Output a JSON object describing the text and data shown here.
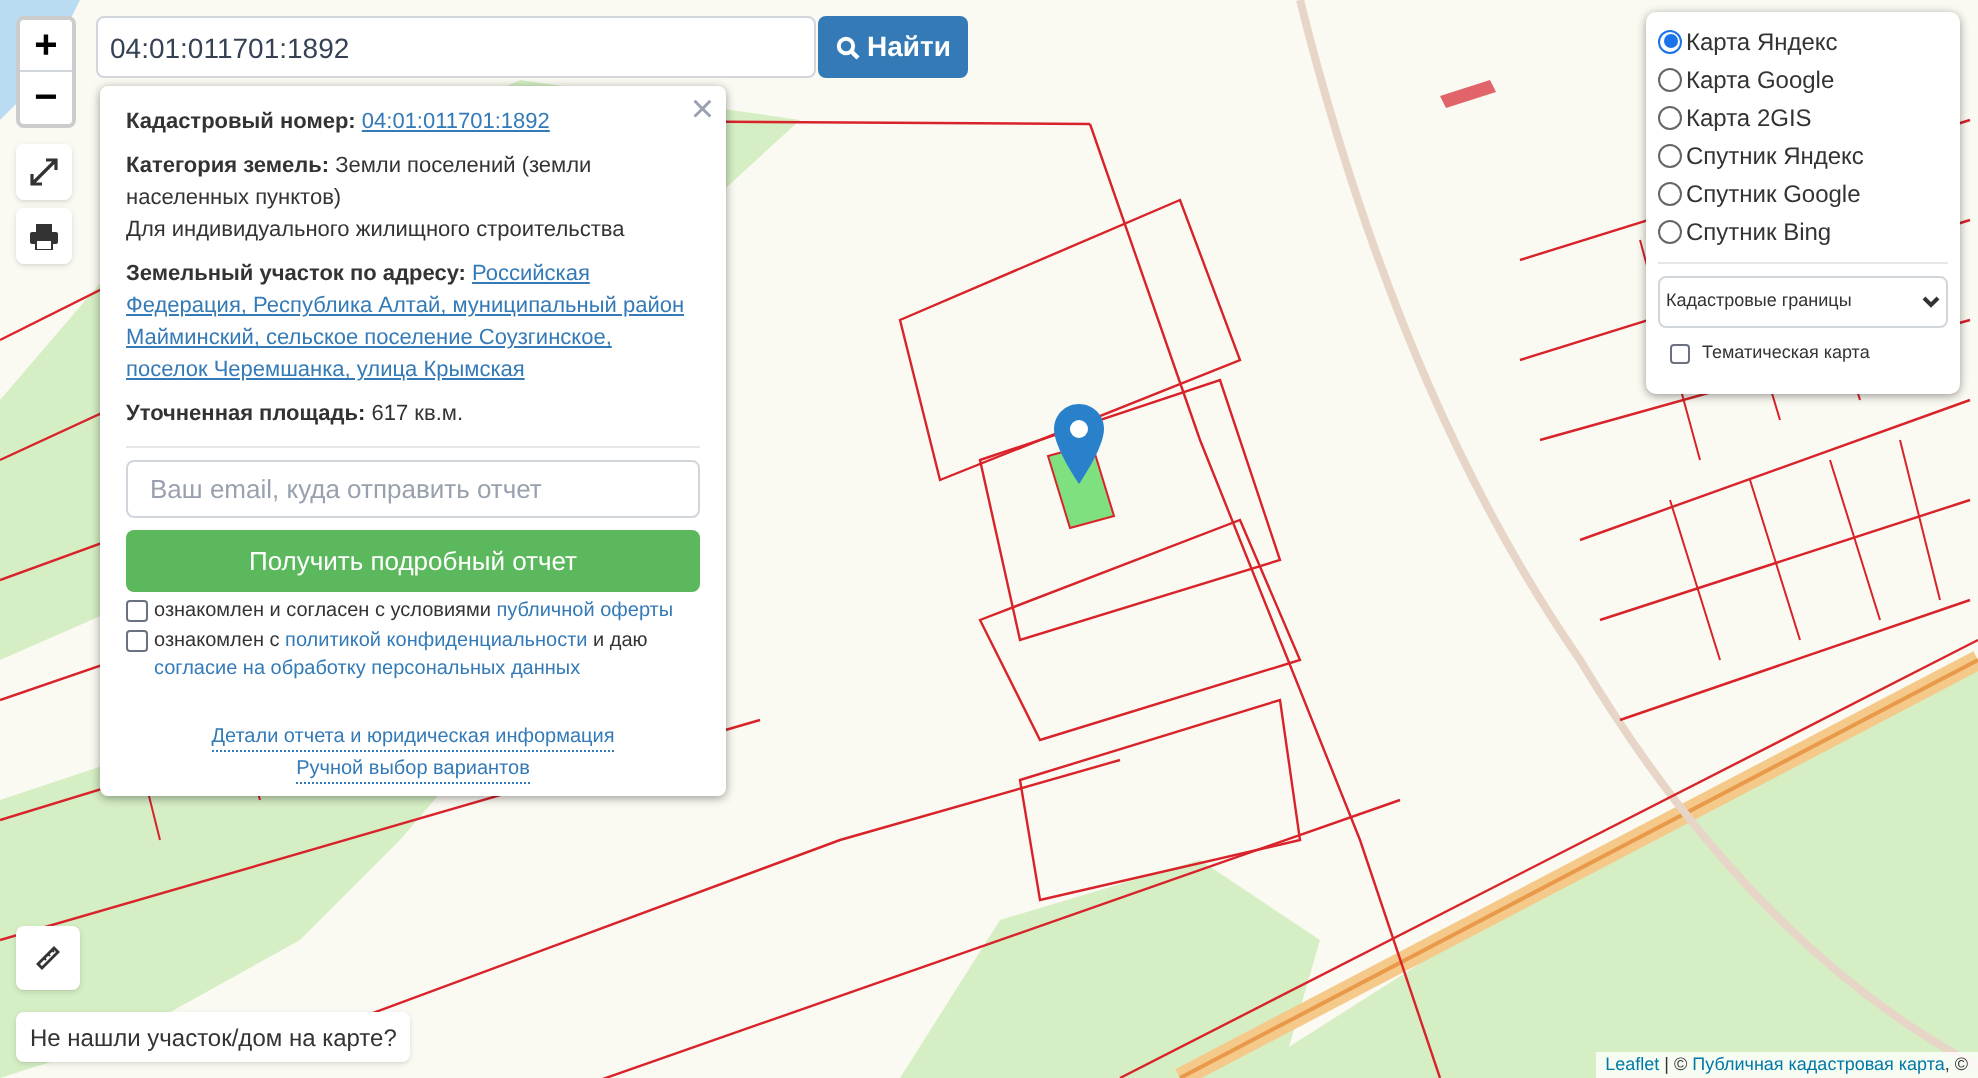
{
  "search": {
    "value": "04:01:011701:1892",
    "button": "Найти"
  },
  "zoom": {
    "plus": "+",
    "minus": "−"
  },
  "info_panel": {
    "close": "×",
    "fields": [
      {
        "kind": "link",
        "label": "Кадастровый номер:",
        "value": "04:01:011701:1892"
      },
      {
        "kind": "text",
        "label": "Категория земель:",
        "value": "Земли поселений (земли населенных пунктов)"
      },
      {
        "kind": "note",
        "value": "Для индивидуального жилищного строительства"
      },
      {
        "kind": "link",
        "label": "Земельный участок по адресу:",
        "value": "Российская Федерация, Республика Алтай, муниципальный район Майминский, сельское поселение Соузгинское, поселок Черемшанка, улица Крымская"
      },
      {
        "kind": "text",
        "label": "Уточненная площадь:",
        "value": "617 кв.м."
      }
    ],
    "email_placeholder": "Ваш email, куда отправить отчет",
    "submit": "Получить подробный отчет",
    "consents": [
      {
        "checked": false,
        "parts": [
          {
            "kind": "text",
            "text": "ознакомлен и согласен с условиями "
          },
          {
            "kind": "link",
            "text": "публичной оферты"
          }
        ]
      },
      {
        "checked": false,
        "parts": [
          {
            "kind": "text",
            "text": "ознакомлен с "
          },
          {
            "kind": "link",
            "text": "политикой конфиденциальности"
          },
          {
            "kind": "text",
            "text": " и даю "
          },
          {
            "kind": "link",
            "text": "согласие на обработку персональных данных"
          }
        ]
      }
    ],
    "links": [
      "Детали отчета и юридическая информация",
      "Ручной выбор вариантов"
    ]
  },
  "layers": {
    "options": [
      {
        "label": "Карта Яндекс",
        "selected": true
      },
      {
        "label": "Карта Google",
        "selected": false
      },
      {
        "label": "Карта 2GIS",
        "selected": false
      },
      {
        "label": "Спутник Яндекс",
        "selected": false
      },
      {
        "label": "Спутник Google",
        "selected": false
      },
      {
        "label": "Спутник Bing",
        "selected": false
      }
    ],
    "overlay_select": "Кадастровые границы",
    "thematic": {
      "label": "Тематическая карта",
      "checked": false
    }
  },
  "not_found_hint": "Не нашли участок/дом на карте?",
  "attribution": [
    {
      "kind": "link",
      "text": "Leaflet"
    },
    {
      "kind": "text",
      "text": " | © "
    },
    {
      "kind": "link",
      "text": "Публичная кадастровая карта"
    },
    {
      "kind": "text",
      "text": ", ©"
    }
  ]
}
